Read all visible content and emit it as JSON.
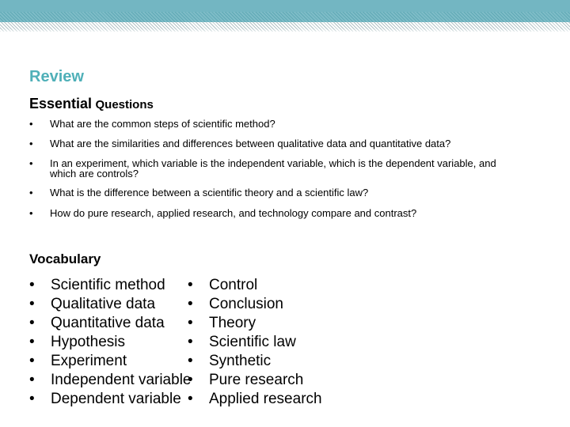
{
  "header": {
    "accent_color": "#73b6c2",
    "title_color": "#4fb0b8"
  },
  "slide": {
    "title": "Review",
    "subtitle_big": "Essential",
    "subtitle_small": "Questions",
    "bullet": "•",
    "questions": [
      "What are the common steps of scientific method?",
      "What are the similarities and differences between qualitative data and quantitative data?",
      "In an experiment, which variable is the independent variable, which is the dependent variable, and which are controls?",
      "What is the difference between a scientific theory and a scientific law?",
      "How do pure research, applied research, and technology compare and contrast?"
    ],
    "vocab_title": "Vocabulary",
    "vocab_left": [
      "Scientific method",
      "Qualitative data",
      "Quantitative data",
      "Hypothesis",
      "Experiment",
      "Independent variable",
      "Dependent variable"
    ],
    "vocab_right": [
      "Control",
      "Conclusion",
      "Theory",
      "Scientific law",
      "Synthetic",
      "Pure research",
      "Applied research"
    ]
  }
}
